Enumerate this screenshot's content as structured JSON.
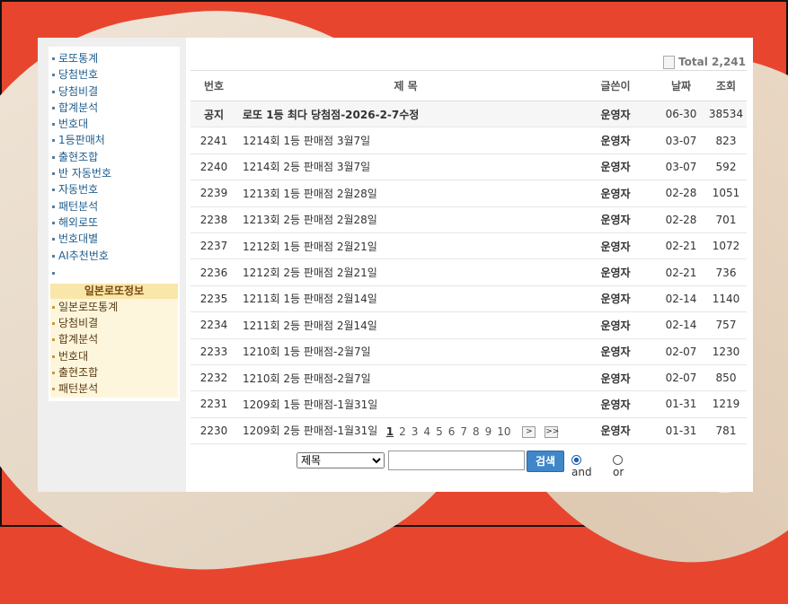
{
  "sidebar": {
    "items": [
      "로또통계",
      "당첨번호",
      "당첨비결",
      "합계분석",
      "번호대",
      "1등판매처",
      "출현조합",
      "반 자동번호",
      "자동번호",
      "패턴분석",
      "해외로또",
      "번호대별",
      "AI추천번호"
    ],
    "japan_header": "일본로또정보",
    "japan_items": [
      "일본로또통계",
      "당첨비결",
      "합계분석",
      "번호대",
      "출현조합",
      "패턴분석"
    ]
  },
  "board": {
    "total": "Total 2,241",
    "headers": {
      "num": "번호",
      "title": "제 목",
      "author": "글쓴이",
      "date": "날짜",
      "views": "조회"
    },
    "notice": {
      "num": "공지",
      "title": "로또 1등 최다 당첨점-2026-2-7수정",
      "author": "운영자",
      "date": "06-30",
      "views": "38534"
    },
    "rows": [
      {
        "num": "2241",
        "title": "1214회 1등 판매점 3월7일",
        "author": "운영자",
        "date": "03-07",
        "views": "823"
      },
      {
        "num": "2240",
        "title": "1214회 2등 판매점 3월7일",
        "author": "운영자",
        "date": "03-07",
        "views": "592"
      },
      {
        "num": "2239",
        "title": "1213회 1등 판매점 2월28일",
        "author": "운영자",
        "date": "02-28",
        "views": "1051"
      },
      {
        "num": "2238",
        "title": "1213회 2등 판매점 2월28일",
        "author": "운영자",
        "date": "02-28",
        "views": "701"
      },
      {
        "num": "2237",
        "title": "1212회 1등 판매점 2월21일",
        "author": "운영자",
        "date": "02-21",
        "views": "1072"
      },
      {
        "num": "2236",
        "title": "1212회 2등 판매점 2월21일",
        "author": "운영자",
        "date": "02-21",
        "views": "736"
      },
      {
        "num": "2235",
        "title": "1211회 1등 판매점 2월14일",
        "author": "운영자",
        "date": "02-14",
        "views": "1140"
      },
      {
        "num": "2234",
        "title": "1211회 2등 판매점 2월14일",
        "author": "운영자",
        "date": "02-14",
        "views": "757"
      },
      {
        "num": "2233",
        "title": "1210회 1등 판매점-2월7일",
        "author": "운영자",
        "date": "02-07",
        "views": "1230"
      },
      {
        "num": "2232",
        "title": "1210회 2등 판매점-2월7일",
        "author": "운영자",
        "date": "02-07",
        "views": "850"
      },
      {
        "num": "2231",
        "title": "1209회 1등 판매점-1월31일",
        "author": "운영자",
        "date": "01-31",
        "views": "1219"
      },
      {
        "num": "2230",
        "title": "1209회 2등 판매점-1월31일",
        "author": "운영자",
        "date": "01-31",
        "views": "781"
      }
    ]
  },
  "pager": {
    "pages": [
      "1",
      "2",
      "3",
      "4",
      "5",
      "6",
      "7",
      "8",
      "9",
      "10"
    ],
    "current": "1",
    "next": ">",
    "last": ">>"
  },
  "search": {
    "selected_option": "제목",
    "query": "",
    "button": "검색",
    "and_label": "and",
    "or_label": "or",
    "selected_mode": "and"
  },
  "colors": {
    "background": "#e8452f",
    "notice_title": "#1f2f8f",
    "search_button": "#3f87c9",
    "japan_header": "#f9e7a9"
  }
}
